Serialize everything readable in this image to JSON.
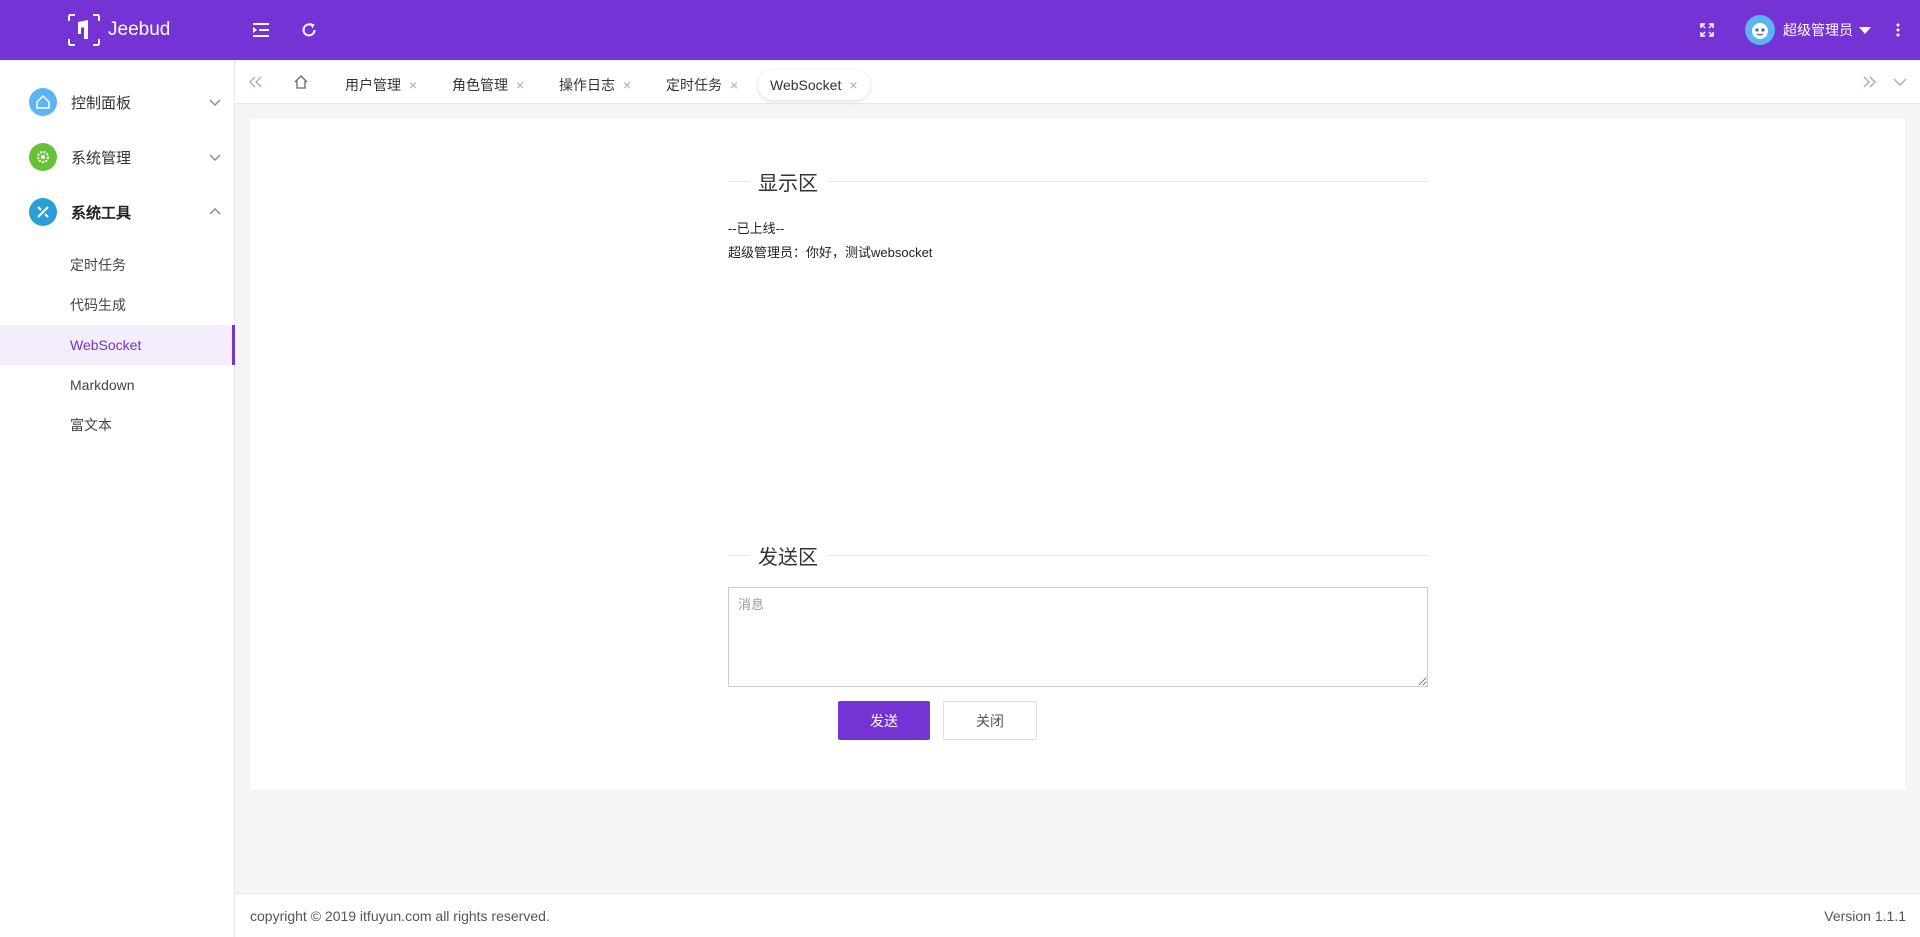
{
  "app": {
    "name": "Jeebud"
  },
  "header": {
    "user_name": "超级管理员"
  },
  "sidebar": {
    "groups": [
      {
        "label": "控制面板",
        "icon": "home-icon",
        "color": "#5cb3f5",
        "expanded": false
      },
      {
        "label": "系统管理",
        "icon": "gear-icon",
        "color": "#67c23a",
        "expanded": false
      },
      {
        "label": "系统工具",
        "icon": "tools-icon",
        "color": "#2a9fd6",
        "expanded": true
      }
    ],
    "sub_items": [
      {
        "label": "定时任务",
        "active": false
      },
      {
        "label": "代码生成",
        "active": false
      },
      {
        "label": "WebSocket",
        "active": true
      },
      {
        "label": "Markdown",
        "active": false
      },
      {
        "label": "富文本",
        "active": false
      }
    ]
  },
  "tabs": [
    {
      "label": "用户管理"
    },
    {
      "label": "角色管理"
    },
    {
      "label": "操作日志"
    },
    {
      "label": "定时任务"
    },
    {
      "label": "WebSocket",
      "active": true
    }
  ],
  "main": {
    "display_title": "显示区",
    "messages": [
      "--已上线--",
      "超级管理员：你好，测试websocket"
    ],
    "send_title": "发送区",
    "input_placeholder": "消息",
    "send_label": "发送",
    "close_label": "关闭"
  },
  "footer": {
    "copyright": "copyright © 2019 itfuyun.com all rights reserved.",
    "version": "Version 1.1.1"
  },
  "colors": {
    "primary": "#7532d4",
    "active_bg": "#f4eefc"
  }
}
